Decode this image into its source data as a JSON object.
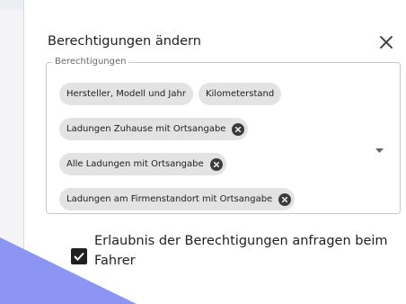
{
  "dialog": {
    "title": "Berechtigungen ändern",
    "close_icon": "close-icon"
  },
  "permissions": {
    "legend": "Berechtigungen",
    "chips": [
      {
        "label": "Hersteller, Modell und Jahr",
        "deletable": false
      },
      {
        "label": "Kilometerstand",
        "deletable": false
      },
      {
        "label": "Ladungen Zuhause mit Ortsangabe",
        "deletable": true
      },
      {
        "label": "Alle Ladungen mit Ortsangabe",
        "deletable": true
      },
      {
        "label": "Ladungen am Firmenstandort mit Ortsangabe",
        "deletable": true
      }
    ],
    "dropdown_icon": "dropdown-arrow-icon"
  },
  "consent": {
    "checked": true,
    "label": "Erlaubnis der Berechtigungen anfragen beim Fahrer"
  },
  "colors": {
    "accent_shape": "#8c94f4",
    "chip_bg": "#e3e3e3",
    "checkbox": "#1f1f1f"
  }
}
